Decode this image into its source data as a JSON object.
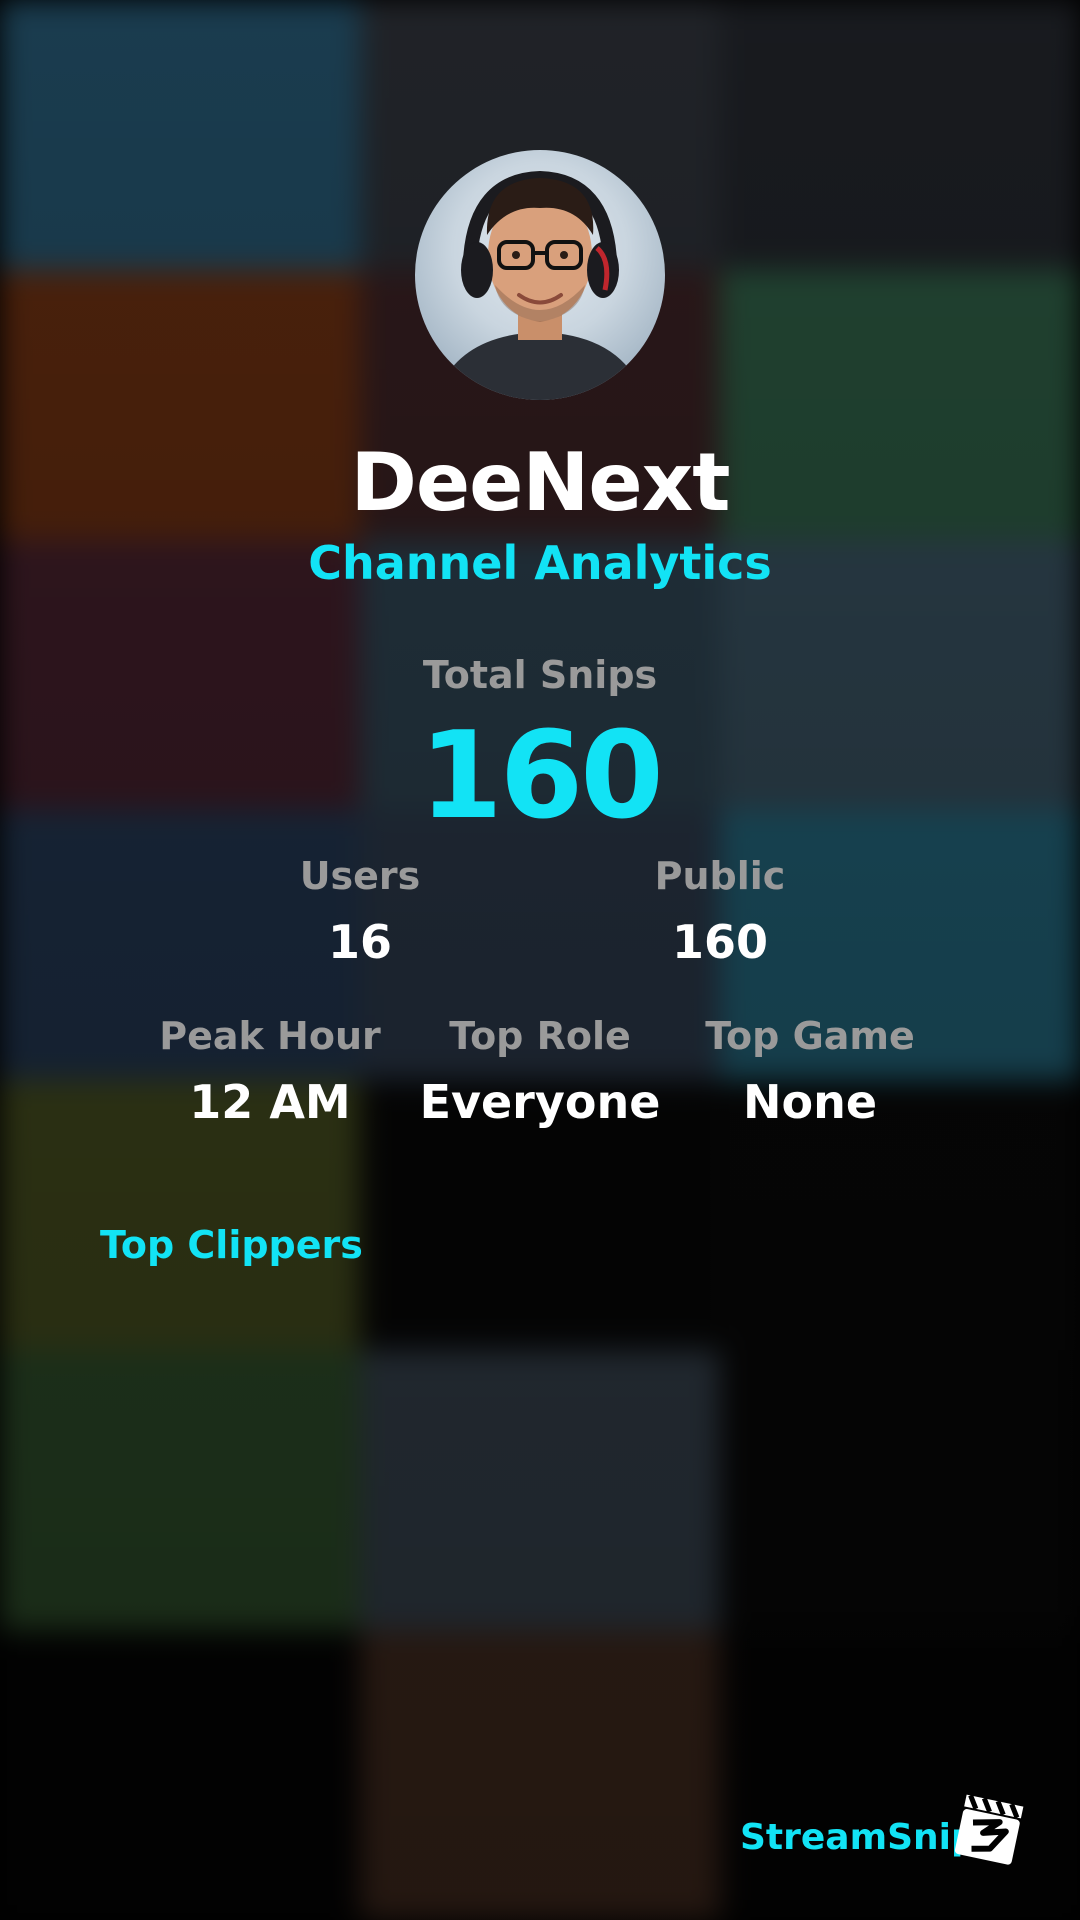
{
  "channel": {
    "name": "DeeNext",
    "subtitle": "Channel Analytics"
  },
  "total_snips": {
    "label": "Total Snips",
    "value": "160"
  },
  "stats_row1": [
    {
      "label": "Users",
      "value": "16"
    },
    {
      "label": "Public",
      "value": "160"
    }
  ],
  "stats_row2": [
    {
      "label": "Peak Hour",
      "value": "12 AM"
    },
    {
      "label": "Top Role",
      "value": "Everyone"
    },
    {
      "label": "Top Game",
      "value": "None"
    }
  ],
  "top_clippers": {
    "title": "Top Clippers"
  },
  "brand": {
    "name": "StreamSnip"
  },
  "colors": {
    "accent": "#12e3f5",
    "label": "#9a9a9a",
    "text": "#ffffff",
    "background": "#000000"
  },
  "icons": {
    "avatar": "avatar-portrait",
    "brand_logo": "clapperboard-icon"
  }
}
